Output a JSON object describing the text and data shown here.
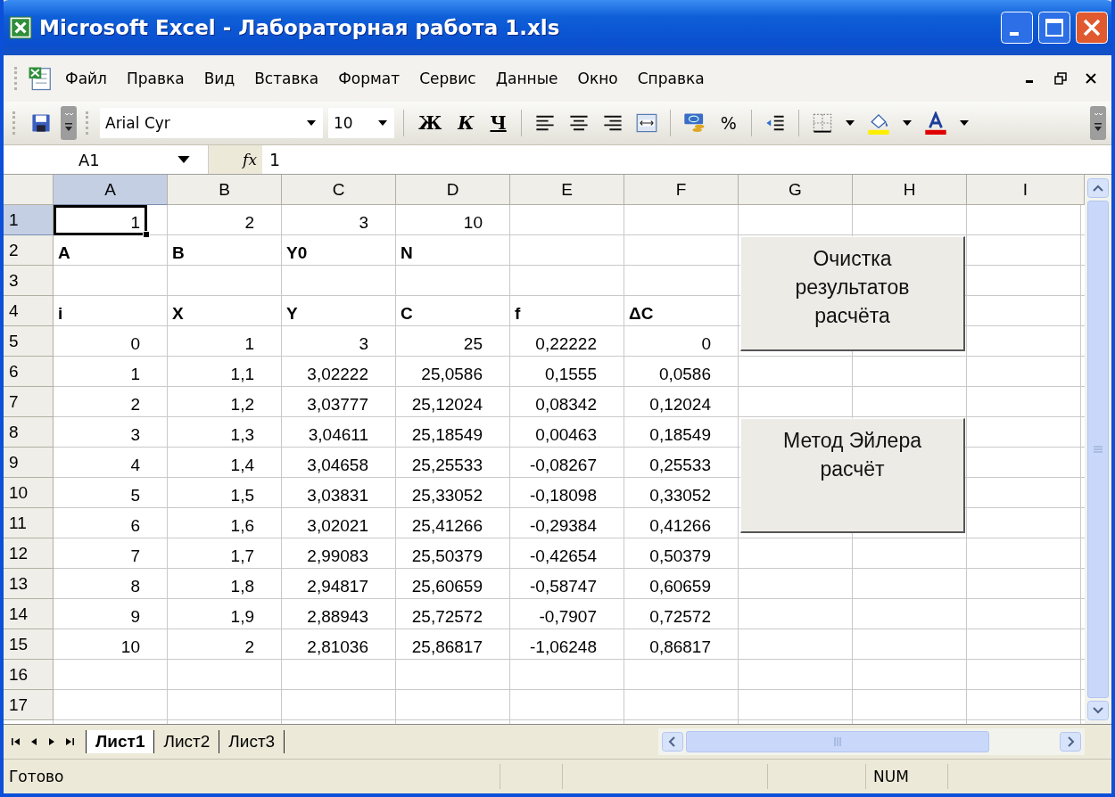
{
  "window": {
    "title": "Microsoft Excel - Лабораторная работа 1.xls"
  },
  "menu": [
    {
      "label": "Файл"
    },
    {
      "label": "Правка"
    },
    {
      "label": "Вид"
    },
    {
      "label": "Вставка"
    },
    {
      "label": "Формат"
    },
    {
      "label": "Сервис"
    },
    {
      "label": "Данные"
    },
    {
      "label": "Окно"
    },
    {
      "label": "Справка"
    }
  ],
  "toolbar": {
    "font": "Arial Cyr",
    "size": "10",
    "bold": "Ж",
    "italic": "К",
    "underline": "Ч",
    "percent": "%"
  },
  "formula_bar": {
    "name_box": "A1",
    "fx": "fx",
    "value": "1"
  },
  "columns": [
    {
      "label": "A",
      "selected": true
    },
    {
      "label": "B",
      "selected": false
    },
    {
      "label": "C",
      "selected": false
    },
    {
      "label": "D",
      "selected": false
    },
    {
      "label": "E",
      "selected": false
    },
    {
      "label": "F",
      "selected": false
    },
    {
      "label": "G",
      "selected": false
    },
    {
      "label": "H",
      "selected": false
    },
    {
      "label": "I",
      "selected": false
    }
  ],
  "rows": [
    {
      "label": "1",
      "selected": true,
      "cells": [
        {
          "value": "1",
          "kind": "number"
        },
        {
          "value": "2",
          "kind": "number"
        },
        {
          "value": "3",
          "kind": "number"
        },
        {
          "value": "10",
          "kind": "number"
        }
      ]
    },
    {
      "label": "2",
      "selected": false,
      "cells": [
        {
          "value": "A",
          "kind": "heading"
        },
        {
          "value": "B",
          "kind": "heading"
        },
        {
          "value": "Y0",
          "kind": "heading"
        },
        {
          "value": "N",
          "kind": "heading"
        }
      ]
    },
    {
      "label": "3",
      "selected": false,
      "cells": []
    },
    {
      "label": "4",
      "selected": false,
      "cells": [
        {
          "value": "i",
          "kind": "heading"
        },
        {
          "value": "X",
          "kind": "heading"
        },
        {
          "value": "Y",
          "kind": "heading"
        },
        {
          "value": "C",
          "kind": "heading"
        },
        {
          "value": "f",
          "kind": "heading"
        },
        {
          "value": "ΔC",
          "kind": "heading"
        }
      ]
    },
    {
      "label": "5",
      "selected": false,
      "cells": [
        {
          "value": "0",
          "kind": "number"
        },
        {
          "value": "1",
          "kind": "number"
        },
        {
          "value": "3",
          "kind": "number"
        },
        {
          "value": "25",
          "kind": "number"
        },
        {
          "value": "0,22222",
          "kind": "number"
        },
        {
          "value": "0",
          "kind": "number"
        }
      ]
    },
    {
      "label": "6",
      "selected": false,
      "cells": [
        {
          "value": "1",
          "kind": "number"
        },
        {
          "value": "1,1",
          "kind": "number"
        },
        {
          "value": "3,02222",
          "kind": "number"
        },
        {
          "value": "25,0586",
          "kind": "number"
        },
        {
          "value": "0,1555",
          "kind": "number"
        },
        {
          "value": "0,0586",
          "kind": "number"
        }
      ]
    },
    {
      "label": "7",
      "selected": false,
      "cells": [
        {
          "value": "2",
          "kind": "number"
        },
        {
          "value": "1,2",
          "kind": "number"
        },
        {
          "value": "3,03777",
          "kind": "number"
        },
        {
          "value": "25,12024",
          "kind": "number"
        },
        {
          "value": "0,08342",
          "kind": "number"
        },
        {
          "value": "0,12024",
          "kind": "number"
        }
      ]
    },
    {
      "label": "8",
      "selected": false,
      "cells": [
        {
          "value": "3",
          "kind": "number"
        },
        {
          "value": "1,3",
          "kind": "number"
        },
        {
          "value": "3,04611",
          "kind": "number"
        },
        {
          "value": "25,18549",
          "kind": "number"
        },
        {
          "value": "0,00463",
          "kind": "number"
        },
        {
          "value": "0,18549",
          "kind": "number"
        }
      ]
    },
    {
      "label": "9",
      "selected": false,
      "cells": [
        {
          "value": "4",
          "kind": "number"
        },
        {
          "value": "1,4",
          "kind": "number"
        },
        {
          "value": "3,04658",
          "kind": "number"
        },
        {
          "value": "25,25533",
          "kind": "number"
        },
        {
          "value": "-0,08267",
          "kind": "number"
        },
        {
          "value": "0,25533",
          "kind": "number"
        }
      ]
    },
    {
      "label": "10",
      "selected": false,
      "cells": [
        {
          "value": "5",
          "kind": "number"
        },
        {
          "value": "1,5",
          "kind": "number"
        },
        {
          "value": "3,03831",
          "kind": "number"
        },
        {
          "value": "25,33052",
          "kind": "number"
        },
        {
          "value": "-0,18098",
          "kind": "number"
        },
        {
          "value": "0,33052",
          "kind": "number"
        }
      ]
    },
    {
      "label": "11",
      "selected": false,
      "cells": [
        {
          "value": "6",
          "kind": "number"
        },
        {
          "value": "1,6",
          "kind": "number"
        },
        {
          "value": "3,02021",
          "kind": "number"
        },
        {
          "value": "25,41266",
          "kind": "number"
        },
        {
          "value": "-0,29384",
          "kind": "number"
        },
        {
          "value": "0,41266",
          "kind": "number"
        }
      ]
    },
    {
      "label": "12",
      "selected": false,
      "cells": [
        {
          "value": "7",
          "kind": "number"
        },
        {
          "value": "1,7",
          "kind": "number"
        },
        {
          "value": "2,99083",
          "kind": "number"
        },
        {
          "value": "25,50379",
          "kind": "number"
        },
        {
          "value": "-0,42654",
          "kind": "number"
        },
        {
          "value": "0,50379",
          "kind": "number"
        }
      ]
    },
    {
      "label": "13",
      "selected": false,
      "cells": [
        {
          "value": "8",
          "kind": "number"
        },
        {
          "value": "1,8",
          "kind": "number"
        },
        {
          "value": "2,94817",
          "kind": "number"
        },
        {
          "value": "25,60659",
          "kind": "number"
        },
        {
          "value": "-0,58747",
          "kind": "number"
        },
        {
          "value": "0,60659",
          "kind": "number"
        }
      ]
    },
    {
      "label": "14",
      "selected": false,
      "cells": [
        {
          "value": "9",
          "kind": "number"
        },
        {
          "value": "1,9",
          "kind": "number"
        },
        {
          "value": "2,88943",
          "kind": "number"
        },
        {
          "value": "25,72572",
          "kind": "number"
        },
        {
          "value": "-0,7907",
          "kind": "number"
        },
        {
          "value": "0,72572",
          "kind": "number"
        }
      ]
    },
    {
      "label": "15",
      "selected": false,
      "cells": [
        {
          "value": "10",
          "kind": "number"
        },
        {
          "value": "2",
          "kind": "number"
        },
        {
          "value": "2,81036",
          "kind": "number"
        },
        {
          "value": "25,86817",
          "kind": "number"
        },
        {
          "value": "-1,06248",
          "kind": "number"
        },
        {
          "value": "0,86817",
          "kind": "number"
        }
      ]
    },
    {
      "label": "16",
      "selected": false,
      "cells": []
    },
    {
      "label": "17",
      "selected": false,
      "cells": []
    }
  ],
  "sheet_buttons": [
    {
      "label": "Очистка\nрезультатов\nрасчёта"
    },
    {
      "label": "Метод Эйлера\nрасчёт"
    }
  ],
  "sheet_tabs": [
    {
      "label": "Лист1",
      "selected": true
    },
    {
      "label": "Лист2",
      "selected": false
    },
    {
      "label": "Лист3",
      "selected": false
    }
  ],
  "status_bar": {
    "message": "Готово",
    "indicator": "NUM"
  }
}
